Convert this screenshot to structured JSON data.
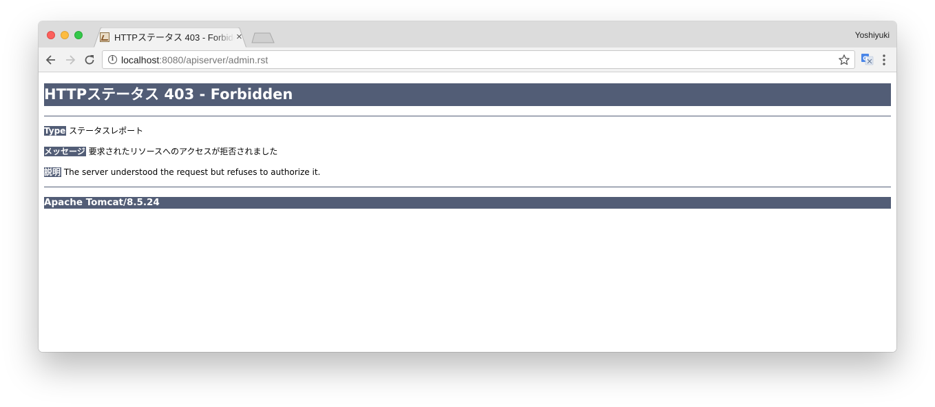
{
  "window": {
    "profile_name": "Yoshiyuki"
  },
  "tabs": [
    {
      "title": "HTTPステータス 403 - Forbidden",
      "close_glyph": "×"
    }
  ],
  "toolbar": {
    "url_host": "localhost",
    "url_rest": ":8080/apiserver/admin.rst"
  },
  "page": {
    "heading": "HTTPステータス 403 - Forbidden",
    "type_label": "Type",
    "type_value": "ステータスレポート",
    "message_label": "メッセージ",
    "message_value": "要求されたリソースへのアクセスが拒否されました",
    "description_label": "説明",
    "description_value": "The server understood the request but refuses to authorize it.",
    "footer": "Apache Tomcat/8.5.24"
  },
  "colors": {
    "tomcat_header": "#525d76",
    "titlebar": "#dcdcdc",
    "toolbar": "#f2f2f2"
  },
  "icons": [
    "close-window-icon",
    "minimize-window-icon",
    "maximize-window-icon",
    "tab-favicon",
    "tab-close-icon",
    "new-tab-icon",
    "back-icon",
    "forward-icon",
    "reload-icon",
    "info-icon",
    "bookmark-star-icon",
    "translate-icon",
    "menu-icon"
  ]
}
